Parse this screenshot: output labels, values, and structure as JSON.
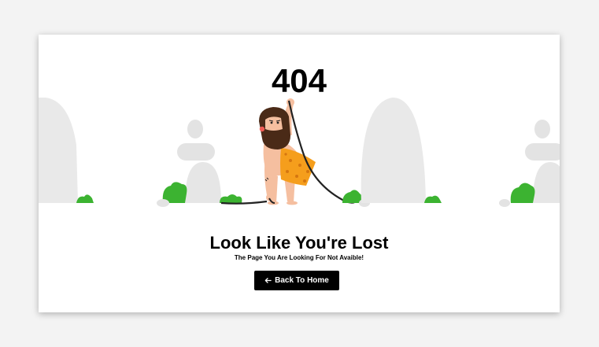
{
  "error": {
    "code": "404",
    "heading": "Look Like You're Lost",
    "subheading": "The Page You Are Looking For Not Avaible!"
  },
  "actions": {
    "home_label": "Back To Home",
    "home_icon": "arrow-left-icon"
  },
  "colors": {
    "accent": "#000000",
    "rock": "#e6e6e6",
    "bush": "#3cb331",
    "skin": "#f5bfa0",
    "hair": "#4a2a17",
    "loincloth": "#f59e1c"
  }
}
